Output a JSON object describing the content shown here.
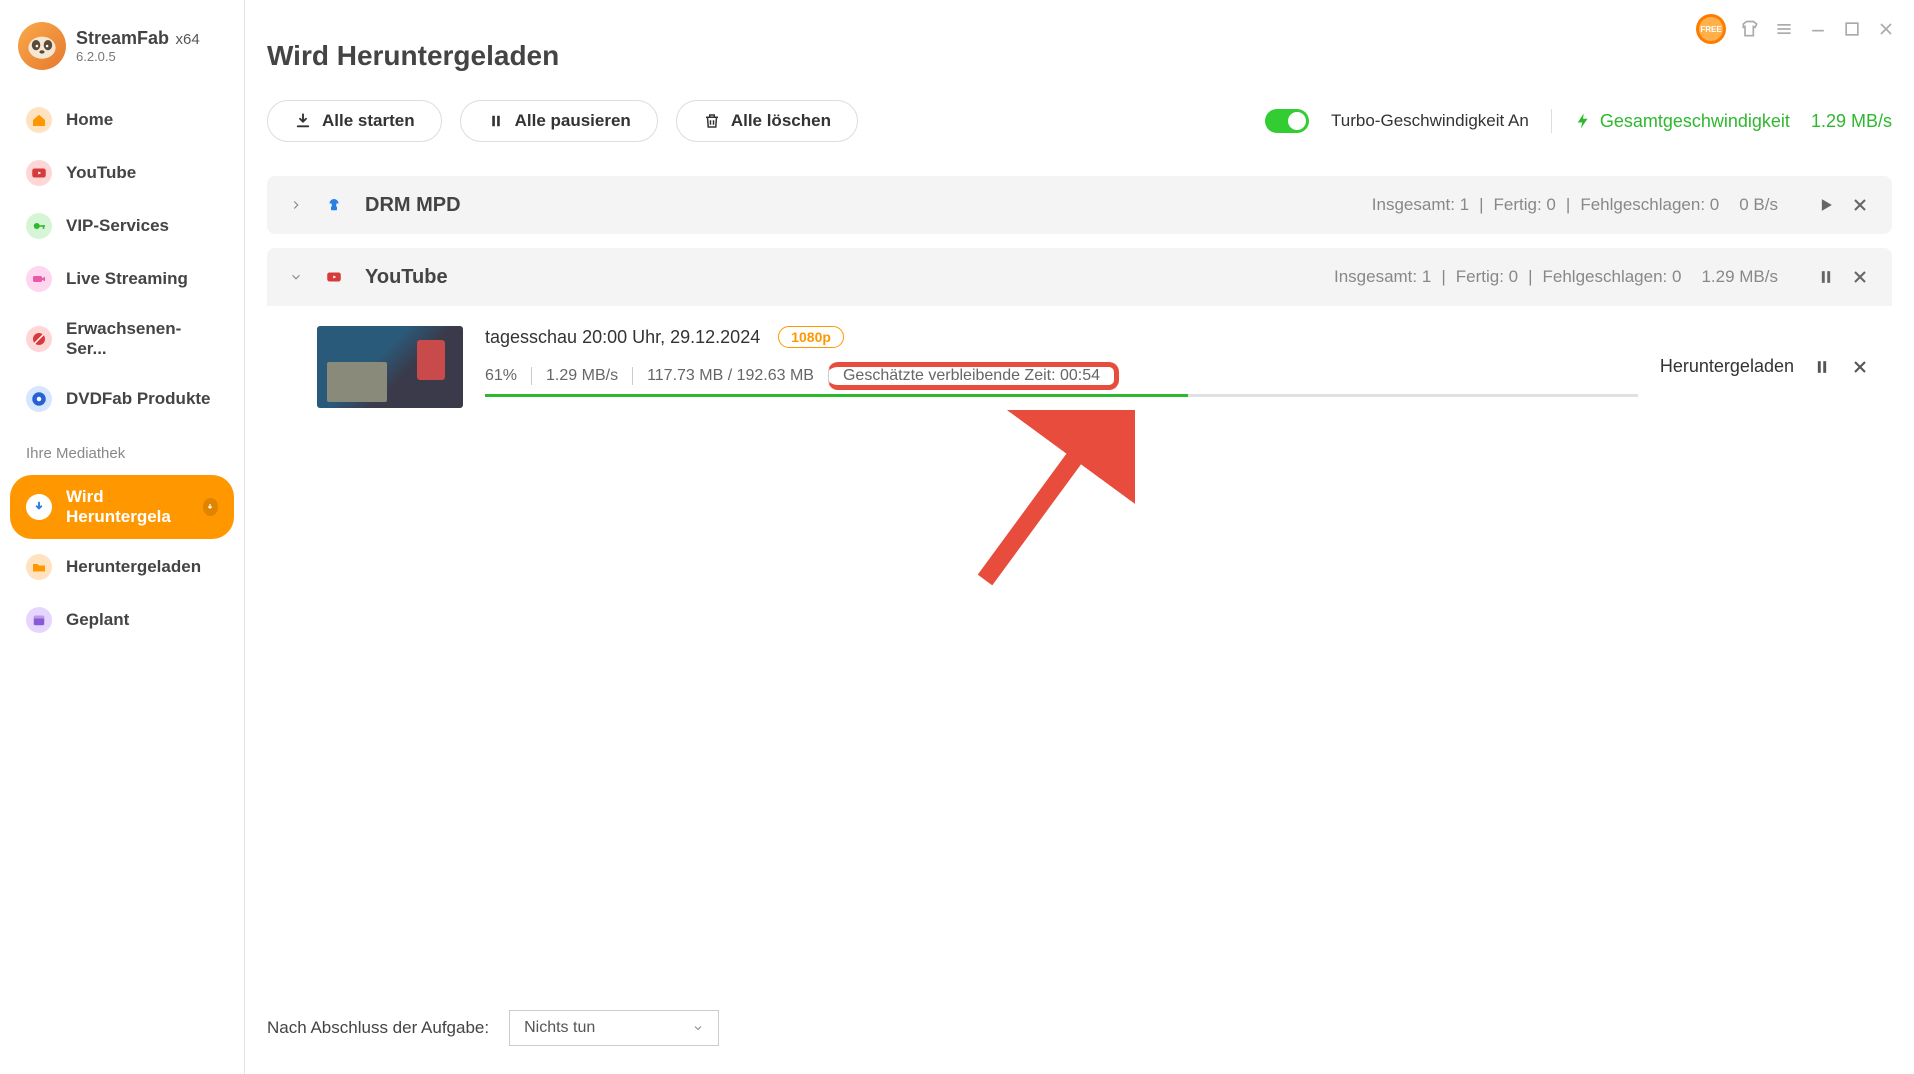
{
  "app": {
    "name": "StreamFab",
    "arch": "x64",
    "version": "6.2.0.5"
  },
  "titlebar": {
    "free_label": "FREE"
  },
  "sidebar": {
    "items": [
      {
        "label": "Home",
        "icon": "home-icon",
        "color_bg": "#ffe3c0",
        "color_fg": "#ff9800"
      },
      {
        "label": "YouTube",
        "icon": "youtube-icon",
        "color_bg": "#ffd6d6",
        "color_fg": "#d63a3a"
      },
      {
        "label": "VIP-Services",
        "icon": "key-icon",
        "color_bg": "#d6f5d6",
        "color_fg": "#2eb82e"
      },
      {
        "label": "Live Streaming",
        "icon": "camera-icon",
        "color_bg": "#ffd6f0",
        "color_fg": "#e85aa8"
      },
      {
        "label": "Erwachsenen-Ser...",
        "icon": "adult-icon",
        "color_bg": "#ffd6d6",
        "color_fg": "#d63a3a"
      },
      {
        "label": "DVDFab Produkte",
        "icon": "dvdfab-icon",
        "color_bg": "#d6e6ff",
        "color_fg": "#2a60d6"
      }
    ],
    "section_label": "Ihre Mediathek",
    "lib": [
      {
        "label": "Wird Heruntergela",
        "icon": "download-icon",
        "active": true
      },
      {
        "label": "Heruntergeladen",
        "icon": "folder-icon",
        "color_bg": "#ffe3c0",
        "color_fg": "#ff9800"
      },
      {
        "label": "Geplant",
        "icon": "calendar-icon",
        "color_bg": "#e6d6ff",
        "color_fg": "#8a5ad6"
      }
    ]
  },
  "page": {
    "title": "Wird Heruntergeladen"
  },
  "toolbar": {
    "start_all": "Alle starten",
    "pause_all": "Alle pausieren",
    "delete_all": "Alle löschen",
    "turbo_label": "Turbo-Geschwindigkeit An",
    "total_speed_label": "Gesamtgeschwindigkeit",
    "total_speed_value": "1.29 MB/s"
  },
  "groups": [
    {
      "name": "DRM MPD",
      "icon": "mpd-icon",
      "expanded": false,
      "stats": {
        "total_label": "Insgesamt:",
        "total": "1",
        "done_label": "Fertig:",
        "done": "0",
        "fail_label": "Fehlgeschlagen:",
        "fail": "0",
        "speed": "0 B/s"
      }
    },
    {
      "name": "YouTube",
      "icon": "youtube-icon",
      "expanded": true,
      "stats": {
        "total_label": "Insgesamt:",
        "total": "1",
        "done_label": "Fertig:",
        "done": "0",
        "fail_label": "Fehlgeschlagen:",
        "fail": "0",
        "speed": "1.29 MB/s"
      },
      "items": [
        {
          "title": "tagesschau 20:00 Uhr, 29.12.2024",
          "quality": "1080p",
          "percent": "61%",
          "speed": "1.29 MB/s",
          "size": "117.73 MB / 192.63 MB",
          "eta_label": "Geschätzte verbleibende Zeit:",
          "eta_value": "00:54",
          "progress_pct": 61,
          "status": "Heruntergeladen"
        }
      ]
    }
  ],
  "footer": {
    "label": "Nach Abschluss der Aufgabe:",
    "select_value": "Nichts tun"
  }
}
